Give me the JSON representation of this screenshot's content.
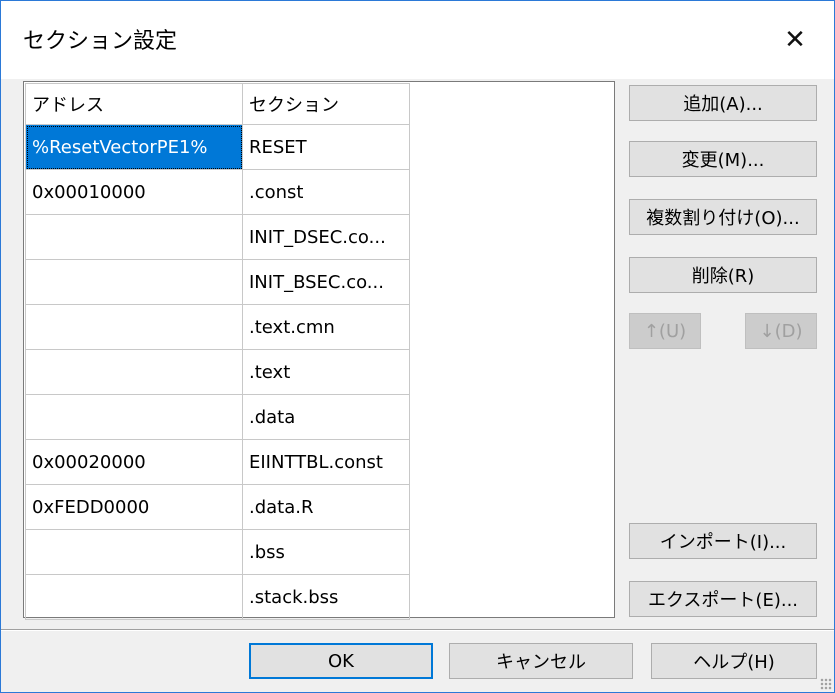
{
  "window": {
    "title": "セクション設定",
    "close_label": "✕"
  },
  "table": {
    "headers": [
      "アドレス",
      "セクション"
    ],
    "rows": [
      {
        "address": "%ResetVectorPE1%",
        "section": "RESET",
        "selected": true
      },
      {
        "address": "0x00010000",
        "section": ".const"
      },
      {
        "address": "",
        "section": "INIT_DSEC.co..."
      },
      {
        "address": "",
        "section": "INIT_BSEC.co..."
      },
      {
        "address": "",
        "section": ".text.cmn"
      },
      {
        "address": "",
        "section": ".text"
      },
      {
        "address": "",
        "section": ".data"
      },
      {
        "address": "0x00020000",
        "section": "EIINTTBL.const"
      },
      {
        "address": "0xFEDD0000",
        "section": ".data.R"
      },
      {
        "address": "",
        "section": ".bss"
      },
      {
        "address": "",
        "section": ".stack.bss"
      }
    ]
  },
  "buttons": {
    "add": "追加(A)...",
    "change": "変更(M)...",
    "multi_assign": "複数割り付け(O)...",
    "delete": "削除(R)",
    "up": "↑(U)",
    "down": "↓(D)",
    "import": "インポート(I)...",
    "export": "エクスポート(E)...",
    "ok": "OK",
    "cancel": "キャンセル",
    "help": "ヘルプ(H)"
  },
  "colors": {
    "selection": "#0078d7",
    "window_border": "#2b79d7"
  }
}
